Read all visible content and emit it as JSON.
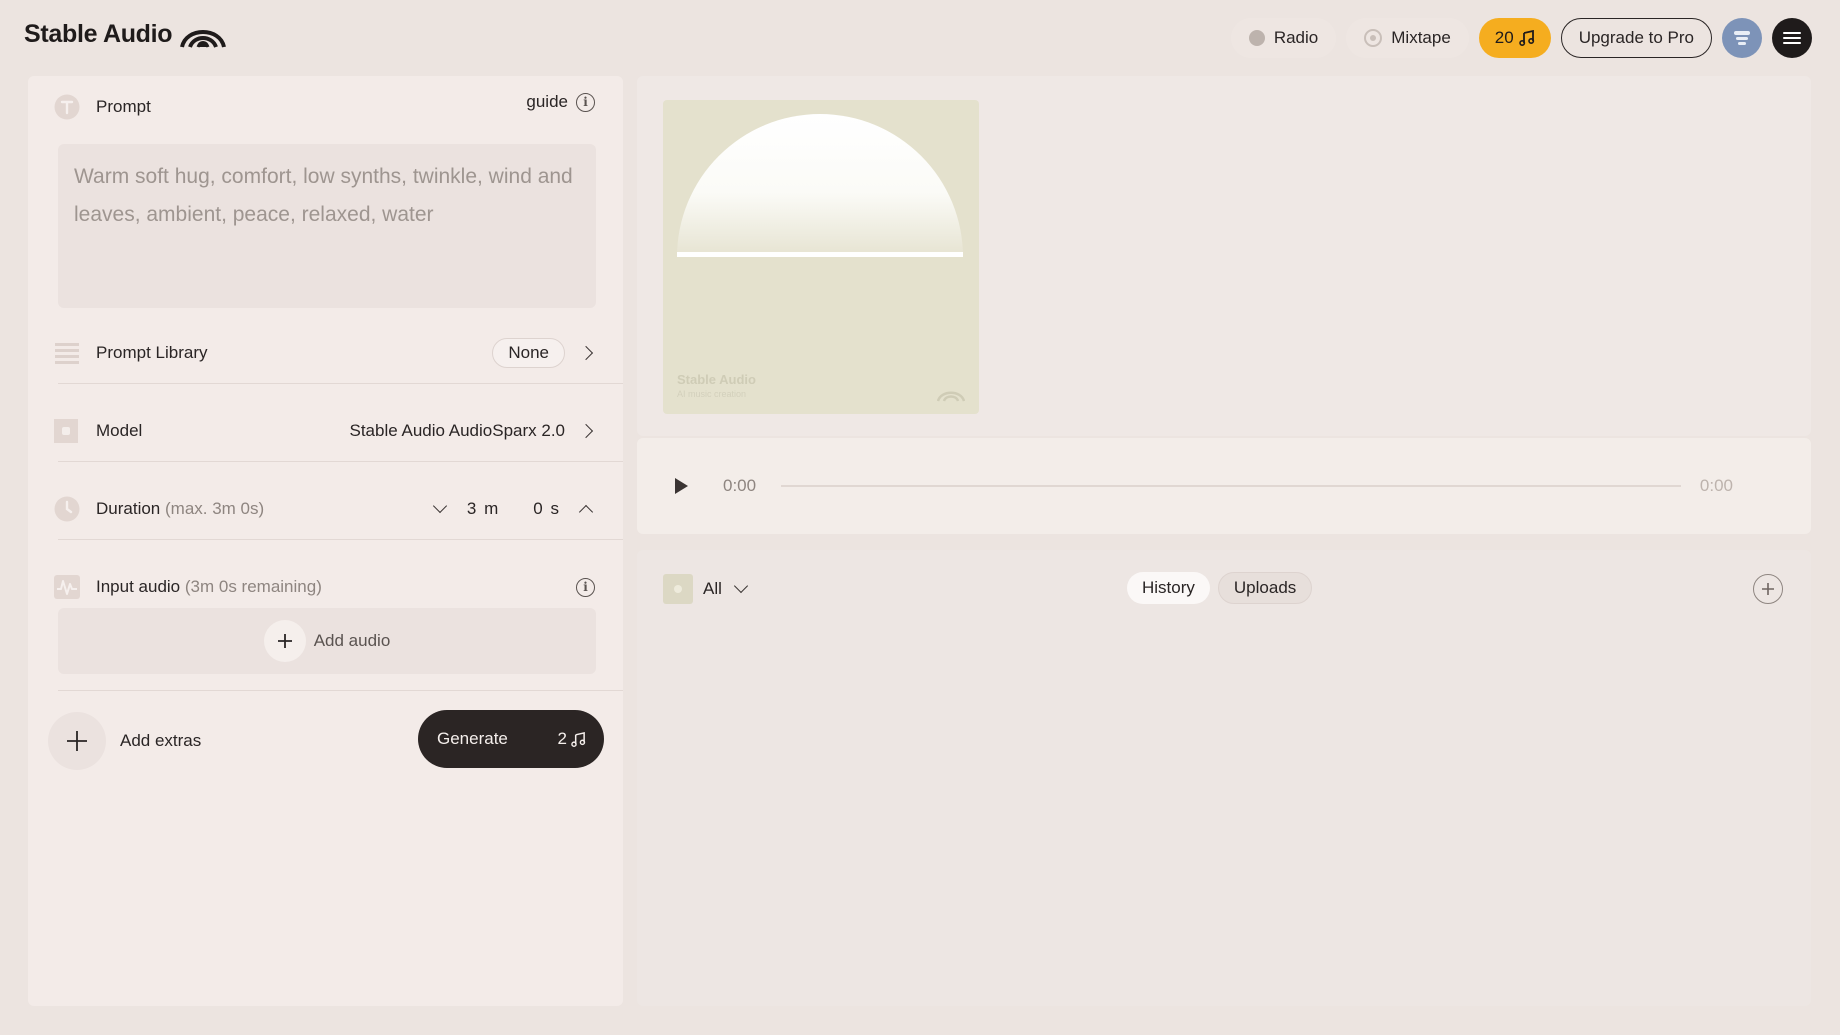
{
  "header": {
    "brand": "Stable Audio",
    "nav": {
      "radio_label": "Radio",
      "mixtape_label": "Mixtape",
      "credits": "20",
      "upgrade_label": "Upgrade to Pro"
    }
  },
  "prompt": {
    "label": "Prompt",
    "guide_label": "guide",
    "placeholder": "Warm soft hug, comfort, low synths, twinkle, wind and leaves, ambient, peace, relaxed, water"
  },
  "prompt_library": {
    "label": "Prompt Library",
    "value": "None"
  },
  "model": {
    "label": "Model",
    "value": "Stable Audio AudioSparx 2.0"
  },
  "duration": {
    "label": "Duration",
    "note": "(max. 3m 0s)",
    "minutes": "3",
    "minutes_unit": "m",
    "seconds": "0",
    "seconds_unit": "s"
  },
  "input_audio": {
    "label": "Input audio",
    "note": "(3m 0s remaining)",
    "add_label": "Add audio"
  },
  "actions": {
    "extras_label": "Add extras",
    "generate_label": "Generate",
    "generate_cost": "2"
  },
  "cover": {
    "title": "Stable Audio",
    "subtitle": "AI music creation"
  },
  "player": {
    "current_time": "0:00",
    "total_time": "0:00",
    "progress": 0
  },
  "library": {
    "filter_label": "All",
    "tabs": [
      {
        "label": "History",
        "active": true
      },
      {
        "label": "Uploads",
        "active": false
      }
    ]
  },
  "colors": {
    "background": "#ece4e0",
    "credits_accent": "#f5ad1f",
    "generate_button": "#2b2524",
    "avatar": "#7d93b8",
    "cover_art": "#e4e1cd"
  }
}
